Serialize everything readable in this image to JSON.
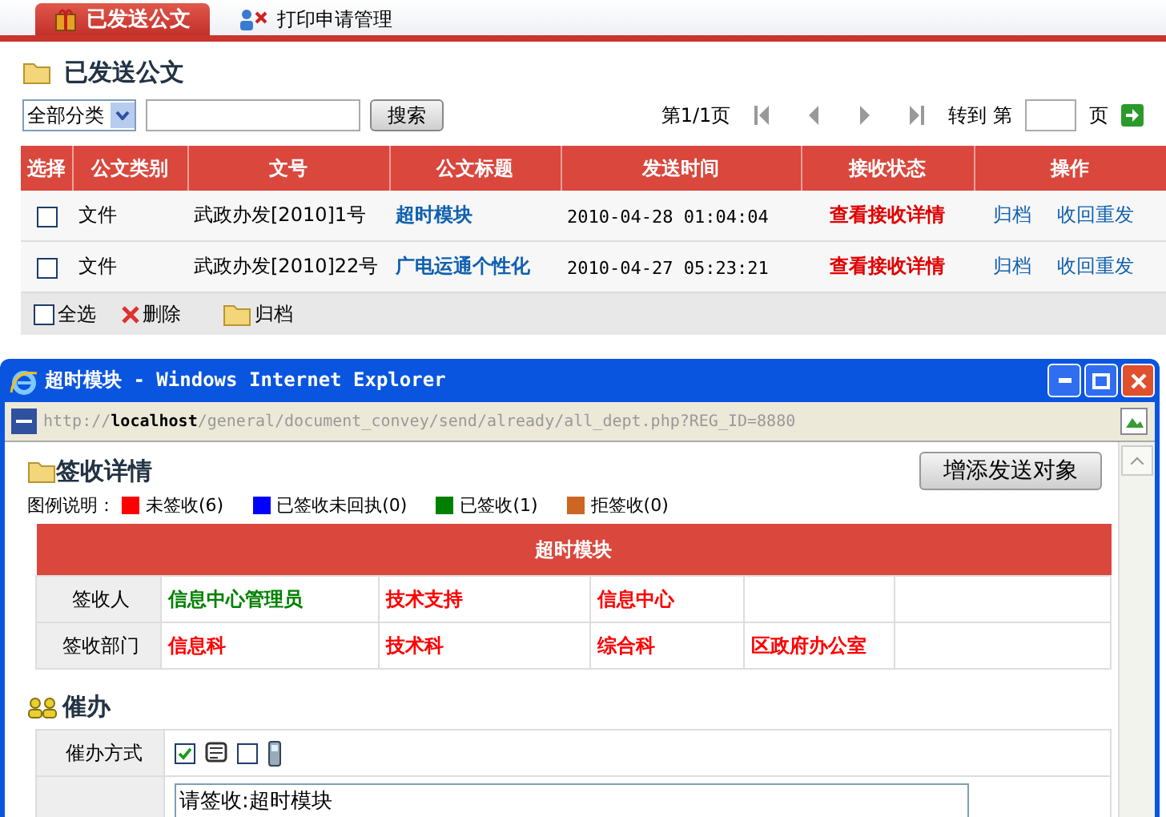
{
  "tabs": [
    {
      "label": "已发送公文",
      "selected": true
    },
    {
      "label": "打印申请管理",
      "selected": false
    }
  ],
  "page_title": "已发送公文",
  "filter": {
    "category": "全部分类",
    "search_button": "搜索"
  },
  "pager": {
    "page_info": "第1/1页",
    "goto_label": "转到 第",
    "page_suffix": "页"
  },
  "table": {
    "columns": [
      "选择",
      "公文类别",
      "文号",
      "公文标题",
      "发送时间",
      "接收状态",
      "操作"
    ],
    "rows": [
      {
        "selected": false,
        "category": "文件",
        "number": "武政办发[2010]1号",
        "title": "超时模块",
        "sent_time": "2010-04-28 01:04:04",
        "status_link": "查看接收详情",
        "actions": [
          "归档",
          "收回重发"
        ]
      },
      {
        "selected": false,
        "category": "文件",
        "number": "武政办发[2010]22号",
        "title": "广电运通个性化",
        "sent_time": "2010-04-27 05:23:21",
        "status_link": "查看接收详情",
        "actions": [
          "归档",
          "收回重发"
        ]
      }
    ]
  },
  "footer": {
    "select_all": {
      "label": "全选",
      "checked": false
    },
    "delete": "删除",
    "archive": "归档"
  },
  "popup": {
    "title": "超时模块 - Windows Internet Explorer",
    "url": "http://**localhost**/general/document_convey/send/already/all_dept.php?REG_ID=8880",
    "heading": "签收详情",
    "add_button": "增添发送对象",
    "legend_label": "图例说明：",
    "legend": [
      {
        "label": "未签收(6)",
        "color": "#ff0000"
      },
      {
        "label": "已签收未回执(0)",
        "color": "#0000ff"
      },
      {
        "label": "已签收(1)",
        "color": "#008000"
      },
      {
        "label": "拒签收(0)",
        "color": "#cc6622"
      }
    ],
    "sign_table": {
      "title": "超时模块",
      "rows": [
        {
          "header": "签收人",
          "cells": [
            {
              "text": "信息中心管理员",
              "color": "#008000"
            },
            {
              "text": "技术支持",
              "color": "#ff0000"
            },
            {
              "text": "信息中心",
              "color": "#ff0000"
            }
          ]
        },
        {
          "header": "签收部门",
          "cells": [
            {
              "text": "信息科",
              "color": "#ff0000"
            },
            {
              "text": "技术科",
              "color": "#ff0000"
            },
            {
              "text": "综合科",
              "color": "#ff0000"
            },
            {
              "text": "区政府办公室",
              "color": "#ff0000"
            }
          ]
        }
      ]
    },
    "urge": {
      "heading": "催办",
      "method_label": "催办方式",
      "methods": [
        {
          "kind": "message",
          "checked": true
        },
        {
          "kind": "phone",
          "checked": false
        }
      ],
      "message": "请签收:超时模块"
    }
  }
}
